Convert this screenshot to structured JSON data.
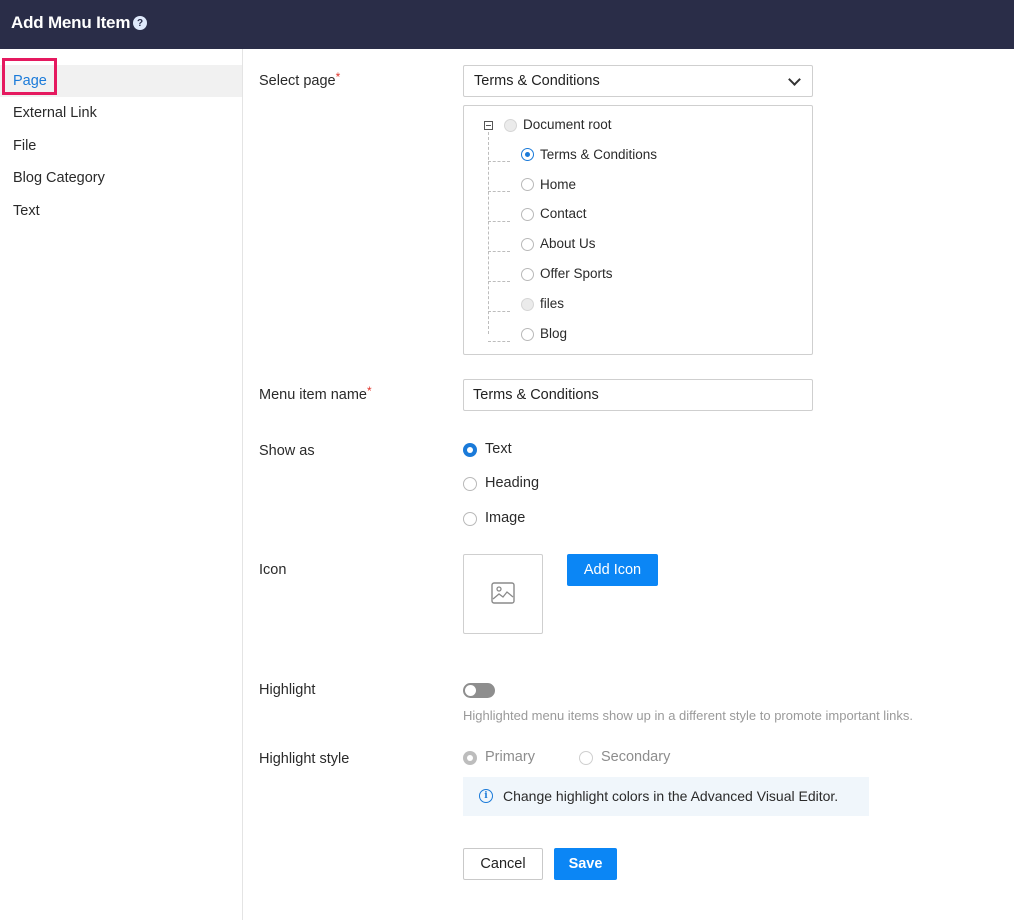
{
  "header": {
    "title": "Add Menu Item",
    "help_icon": "?"
  },
  "sidebar": {
    "items": [
      {
        "label": "Page",
        "active": true
      },
      {
        "label": "External Link"
      },
      {
        "label": "File"
      },
      {
        "label": "Blog Category"
      },
      {
        "label": "Text"
      }
    ]
  },
  "form": {
    "select_page": {
      "label": "Select page",
      "required_mark": "*",
      "value": "Terms & Conditions",
      "tree": {
        "root": "Document root",
        "children": [
          {
            "label": "Terms & Conditions",
            "state": "checked"
          },
          {
            "label": "Home",
            "state": "unchecked"
          },
          {
            "label": "Contact",
            "state": "unchecked"
          },
          {
            "label": "About Us",
            "state": "unchecked"
          },
          {
            "label": "Offer Sports",
            "state": "unchecked"
          },
          {
            "label": "files",
            "state": "disabled"
          },
          {
            "label": "Blog",
            "state": "unchecked"
          }
        ]
      }
    },
    "menu_item_name": {
      "label": "Menu item name",
      "required_mark": "*",
      "value": "Terms & Conditions"
    },
    "show_as": {
      "label": "Show as",
      "options": [
        {
          "label": "Text",
          "selected": true
        },
        {
          "label": "Heading",
          "selected": false
        },
        {
          "label": "Image",
          "selected": false
        }
      ]
    },
    "icon": {
      "label": "Icon",
      "button_label": "Add Icon",
      "placeholder_icon": "image-icon"
    },
    "highlight": {
      "label": "Highlight",
      "enabled": false,
      "hint": "Highlighted menu items show up in a different style to promote important links."
    },
    "highlight_style": {
      "label": "Highlight style",
      "options": [
        {
          "label": "Primary",
          "selected": true
        },
        {
          "label": "Secondary",
          "selected": false
        }
      ],
      "info_icon": "i",
      "info": "Change highlight colors in the Advanced Visual Editor."
    },
    "actions": {
      "cancel_label": "Cancel",
      "save_label": "Save"
    }
  },
  "colors": {
    "header_bg": "#2a2d48",
    "accent": "#0b86f5",
    "active_link": "#1a7ad9",
    "highlight_border": "#e5195f"
  }
}
